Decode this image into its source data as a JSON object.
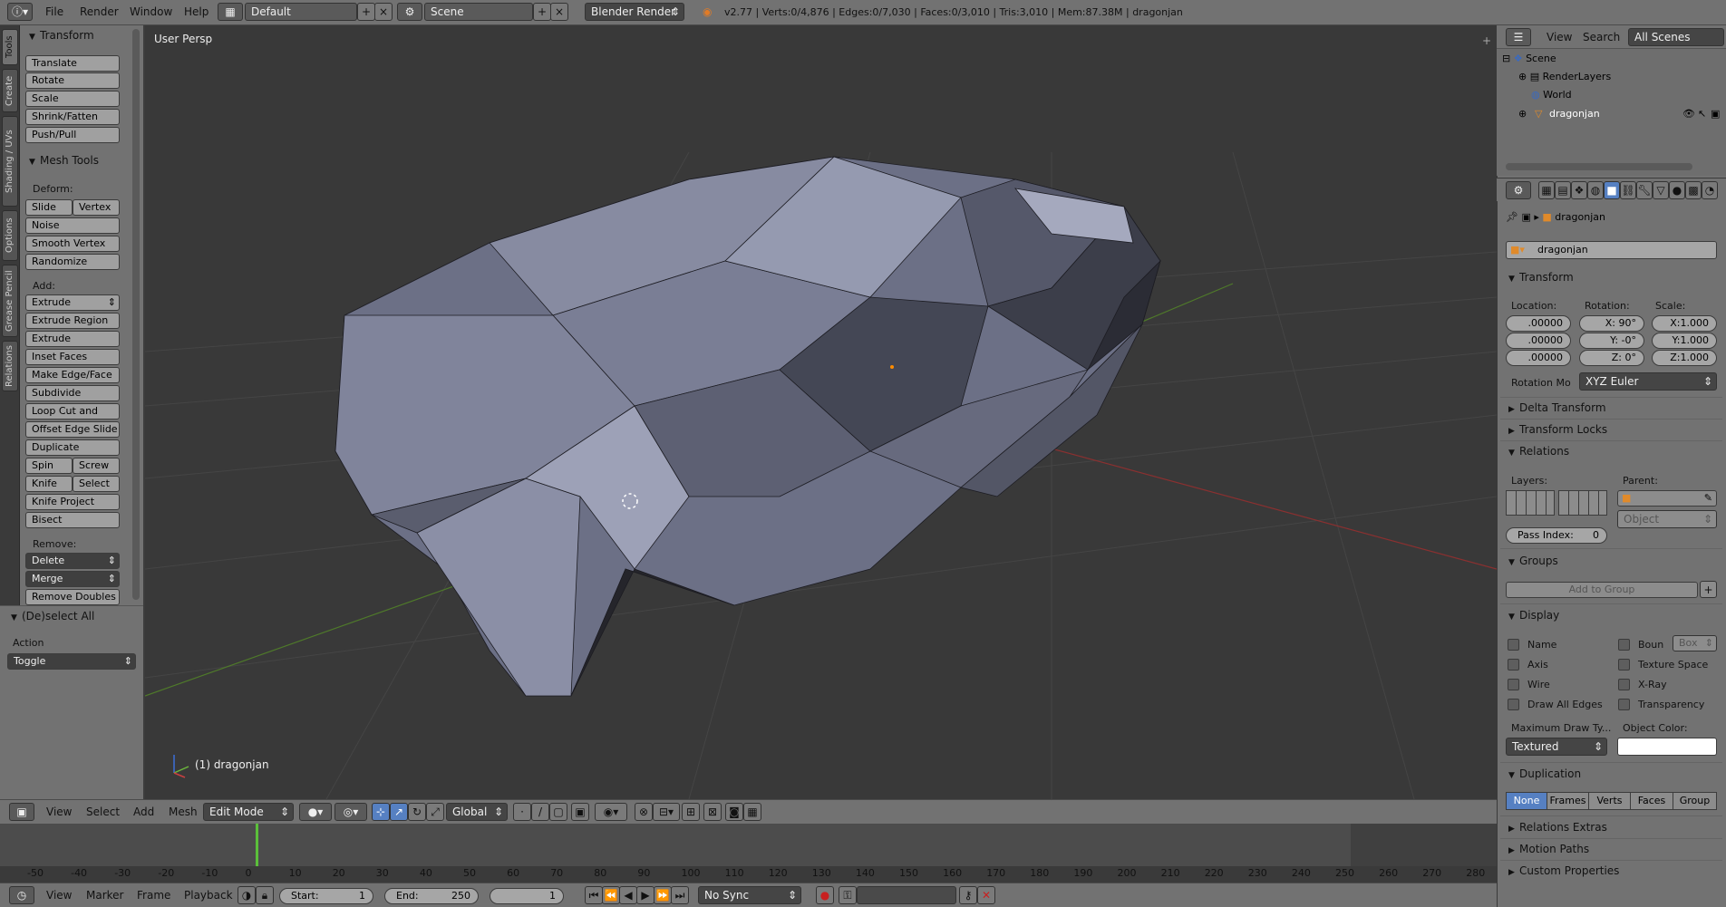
{
  "menus": [
    "File",
    "Render",
    "Window",
    "Help"
  ],
  "screen_layout": "Default",
  "scene": "Scene",
  "render_engine": "Blender Render",
  "stats": "v2.77 | Verts:0/4,876 | Edges:0/7,030 | Faces:0/3,010 | Tris:3,010 | Mem:87.38M | dragonjan",
  "tool_tabs": [
    "Tools",
    "Create",
    "Shading / UVs",
    "Options",
    "Grease Pencil",
    "Relations"
  ],
  "tool_panel": {
    "transform_title": "Transform",
    "transform_buttons": [
      "Translate",
      "Rotate",
      "Scale",
      "Shrink/Fatten",
      "Push/Pull"
    ],
    "mesh_tools_title": "Mesh Tools",
    "deform_label": "Deform:",
    "slide_edge": "Slide Ed",
    "vertex": "Vertex",
    "deform_buttons": [
      "Noise",
      "Smooth Vertex",
      "Randomize"
    ],
    "add_label": "Add:",
    "extrude": "Extrude",
    "add_buttons": [
      "Extrude Region",
      "Extrude Individual",
      "Inset Faces",
      "Make Edge/Face",
      "Subdivide",
      "Loop Cut and Slide",
      "Offset Edge Slide",
      "Duplicate"
    ],
    "spin": "Spin",
    "screw": "Screw",
    "knife": "Knife",
    "select": "Select",
    "knife_project": "Knife Project",
    "bisect": "Bisect",
    "remove_label": "Remove:",
    "delete": "Delete",
    "merge": "Merge",
    "remove_doubles": "Remove Doubles",
    "operator_title": "(De)select All",
    "action_label": "Action",
    "action_value": "Toggle"
  },
  "viewport": {
    "label": "User Persp",
    "object_label": "(1) dragonjan"
  },
  "viewport_header": {
    "menus": [
      "View",
      "Select",
      "Add",
      "Mesh"
    ],
    "mode": "Edit Mode",
    "orientation": "Global"
  },
  "timeline": {
    "ticks": [
      "-50",
      "-40",
      "-30",
      "-20",
      "-10",
      "0",
      "10",
      "20",
      "30",
      "40",
      "50",
      "60",
      "70",
      "80",
      "90",
      "100",
      "110",
      "120",
      "130",
      "140",
      "150",
      "160",
      "170",
      "180",
      "190",
      "200",
      "210",
      "220",
      "230",
      "240",
      "250",
      "260",
      "270",
      "280"
    ],
    "menus": [
      "View",
      "Marker",
      "Frame",
      "Playback"
    ],
    "start_label": "Start:",
    "start": "1",
    "end_label": "End:",
    "end": "250",
    "current": "1",
    "sync": "No Sync"
  },
  "outliner": {
    "menus": [
      "View",
      "Search"
    ],
    "filter": "All Scenes",
    "items": [
      "Scene",
      "RenderLayers",
      "World",
      "dragonjan"
    ]
  },
  "properties": {
    "object_path": "dragonjan",
    "object_name": "dragonjan",
    "transform_title": "Transform",
    "location_label": "Location:",
    "rotation_label": "Rotation:",
    "scale_label": "Scale:",
    "location": [
      ".00000",
      ".00000",
      ".00000"
    ],
    "rotation": [
      "X:   90°",
      "Y:   -0°",
      "Z:    0°"
    ],
    "scale": [
      "X:1.000",
      "Y:1.000",
      "Z:1.000"
    ],
    "rotation_mode_label": "Rotation Mo",
    "rotation_mode": "XYZ Euler",
    "delta_transform": "Delta Transform",
    "transform_locks": "Transform Locks",
    "relations": "Relations",
    "layers_label": "Layers:",
    "parent_label": "Parent:",
    "parent_type": "Object",
    "pass_index_label": "Pass Index:",
    "pass_index": "0",
    "groups": "Groups",
    "add_to_group": "Add to Group",
    "display": "Display",
    "display_checks_left": [
      "Name",
      "Axis",
      "Wire",
      "Draw All Edges"
    ],
    "display_checks_right": [
      "Boun",
      "Texture Space",
      "X-Ray",
      "Transparency"
    ],
    "bounds_type": "Box",
    "max_draw_label": "Maximum Draw Ty...",
    "object_color_label": "Object Color:",
    "max_draw": "Textured",
    "duplication": "Duplication",
    "dup_options": [
      "None",
      "Frames",
      "Verts",
      "Faces",
      "Group"
    ],
    "relations_extras": "Relations Extras",
    "motion_paths": "Motion Paths",
    "custom_properties": "Custom Properties"
  },
  "colors": {
    "accent": "#5680c2",
    "panel": "#727272",
    "viewport": "#393939",
    "mesh": "#7b7f96"
  }
}
